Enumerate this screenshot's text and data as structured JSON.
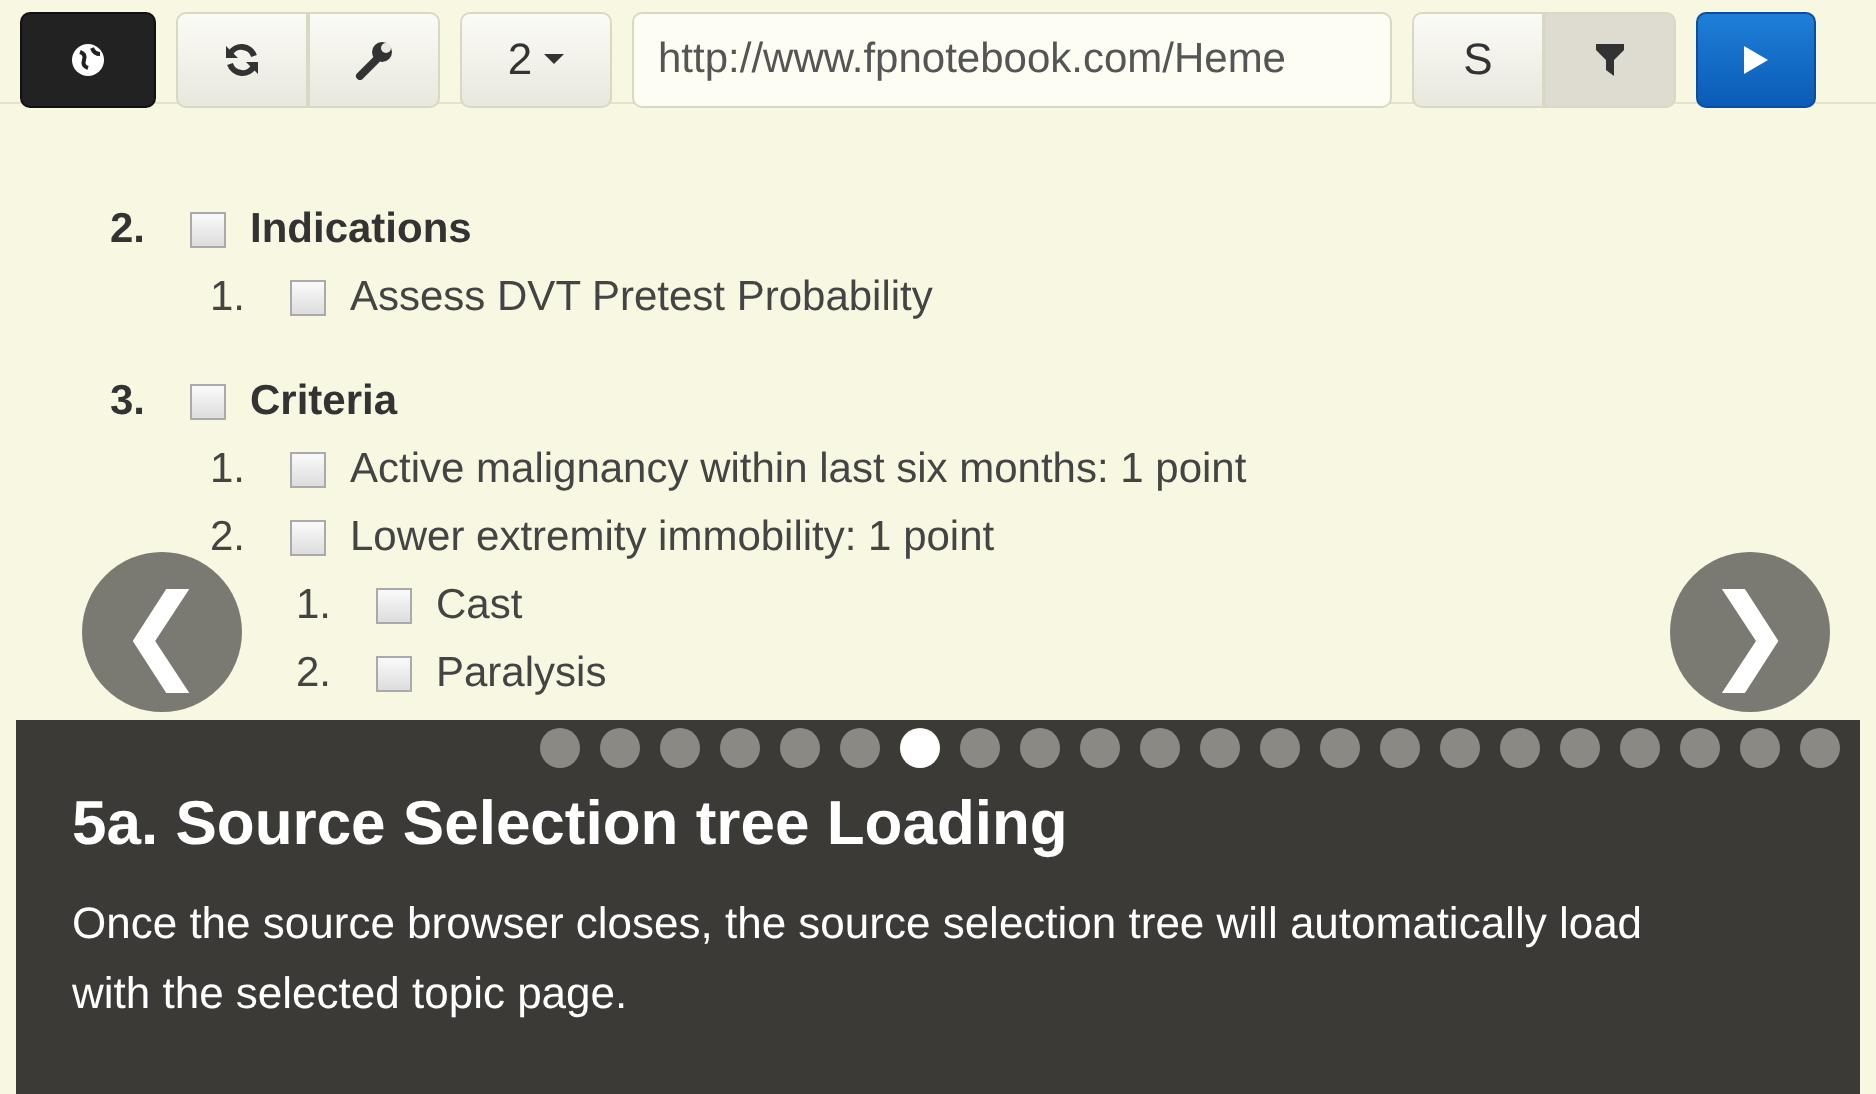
{
  "toolbar": {
    "count_button": "2",
    "url": "http://www.fpnotebook.com/Heme",
    "s_button": "S"
  },
  "outline": [
    {
      "number": "2.",
      "label": "Indications",
      "checked": false,
      "children": [
        {
          "number": "1.",
          "label": "Assess DVT Pretest Probability",
          "checked": false
        }
      ]
    },
    {
      "number": "3.",
      "label": "Criteria",
      "checked": false,
      "children": [
        {
          "number": "1.",
          "label": "Active malignancy within last six months: 1 point",
          "checked": false
        },
        {
          "number": "2.",
          "label": "Lower extremity immobility: 1 point",
          "checked": false,
          "children": [
            {
              "number": "1.",
              "label": "Cast",
              "checked": false
            },
            {
              "number": "2.",
              "label": "Paralysis",
              "checked": false
            }
          ]
        }
      ]
    }
  ],
  "carousel": {
    "prev": "❮",
    "next": "❯",
    "dots": [
      {
        "selected": false
      },
      {
        "selected": false
      },
      {
        "selected": false
      },
      {
        "selected": false
      },
      {
        "selected": false
      },
      {
        "selected": false
      },
      {
        "selected": true
      },
      {
        "selected": false
      },
      {
        "selected": false
      },
      {
        "selected": false
      },
      {
        "selected": false
      },
      {
        "selected": false
      },
      {
        "selected": false
      },
      {
        "selected": false
      },
      {
        "selected": false
      },
      {
        "selected": false
      },
      {
        "selected": false
      },
      {
        "selected": false
      },
      {
        "selected": false
      },
      {
        "selected": false
      },
      {
        "selected": false
      },
      {
        "selected": false
      }
    ],
    "title": "5a. Source Selection tree Loading",
    "body": "Once the source browser closes, the source selection tree will automatically load with the selected topic page."
  }
}
